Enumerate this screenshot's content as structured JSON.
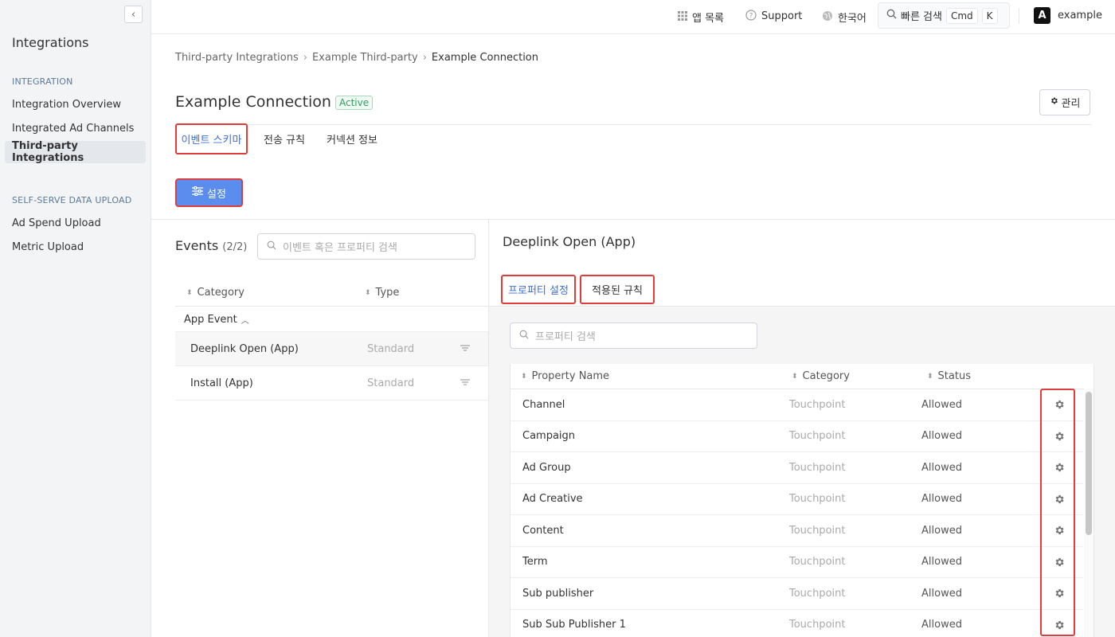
{
  "sidebar": {
    "title": "Integrations",
    "sections": [
      {
        "label": "INTEGRATION",
        "items": [
          {
            "label": "Integration Overview",
            "active": false
          },
          {
            "label": "Integrated Ad Channels",
            "active": false
          },
          {
            "label": "Third-party Integrations",
            "active": true
          }
        ]
      },
      {
        "label": "SELF-SERVE DATA UPLOAD",
        "items": [
          {
            "label": "Ad Spend Upload",
            "active": false
          },
          {
            "label": "Metric Upload",
            "active": false
          }
        ]
      }
    ]
  },
  "topbar": {
    "app_list": "앱 목록",
    "support": "Support",
    "language": "한국어",
    "quick_search": "빠른 검색",
    "kbd_cmd": "Cmd",
    "kbd_k": "K",
    "logo_letter": "A",
    "account": "example"
  },
  "breadcrumb": [
    "Third-party Integrations",
    "Example Third-party",
    "Example Connection"
  ],
  "page": {
    "title": "Example Connection",
    "status": "Active",
    "manage_label": "관리",
    "tabs": [
      "이벤트 스키마",
      "전송 규칙",
      "커넥션 정보"
    ],
    "active_tab": 0,
    "settings_label": "설정"
  },
  "events": {
    "title": "Events",
    "count": "(2/2)",
    "search_placeholder": "이벤트 혹은 프로퍼티 검색",
    "columns": [
      "Category",
      "Type"
    ],
    "group": "App Event",
    "rows": [
      {
        "name": "Deeplink Open (App)",
        "type": "Standard",
        "selected": true
      },
      {
        "name": "Install (App)",
        "type": "Standard",
        "selected": false
      }
    ]
  },
  "detail": {
    "title": "Deeplink Open (App)",
    "tabs": [
      "프로퍼티 설정",
      "적용된 규칙"
    ],
    "active_tab": 0,
    "search_placeholder": "프로퍼티 검색",
    "columns": [
      "Property Name",
      "Category",
      "Status"
    ],
    "rows": [
      {
        "name": "Channel",
        "category": "Touchpoint",
        "status": "Allowed"
      },
      {
        "name": "Campaign",
        "category": "Touchpoint",
        "status": "Allowed"
      },
      {
        "name": "Ad Group",
        "category": "Touchpoint",
        "status": "Allowed"
      },
      {
        "name": "Ad Creative",
        "category": "Touchpoint",
        "status": "Allowed"
      },
      {
        "name": "Content",
        "category": "Touchpoint",
        "status": "Allowed"
      },
      {
        "name": "Term",
        "category": "Touchpoint",
        "status": "Allowed"
      },
      {
        "name": "Sub publisher",
        "category": "Touchpoint",
        "status": "Allowed"
      },
      {
        "name": "Sub Sub Publisher 1",
        "category": "Touchpoint",
        "status": "Allowed"
      }
    ]
  },
  "colors": {
    "accent": "#3b6fd8",
    "primary_button": "#5b8def",
    "highlight": "#e03c3c",
    "active_badge": "#2e9e5b"
  }
}
